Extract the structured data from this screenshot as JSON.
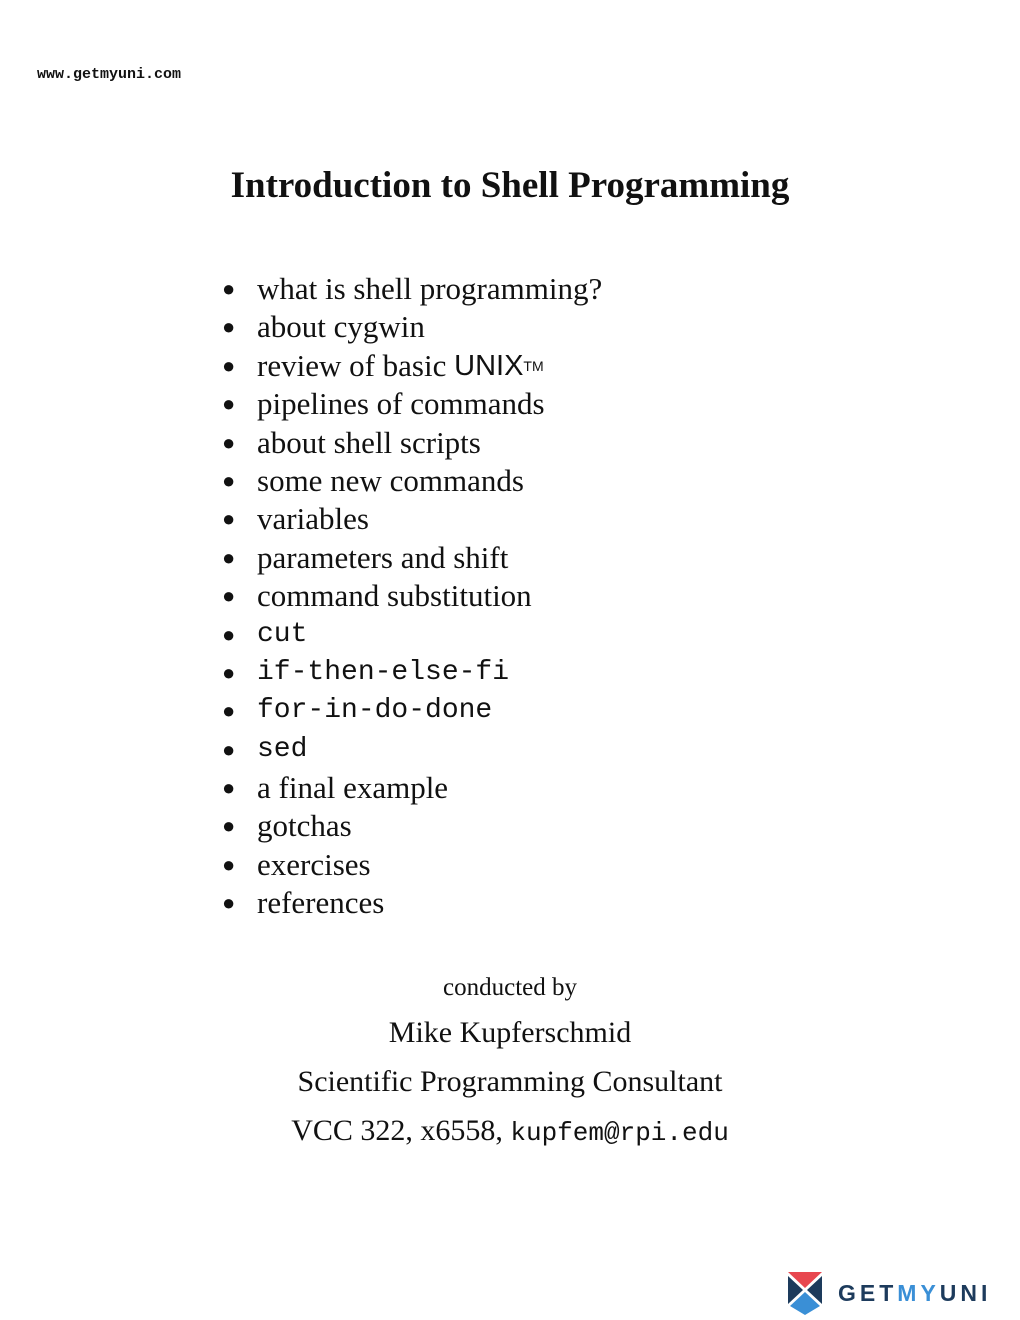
{
  "header": {
    "site_url": "www.getmyuni.com"
  },
  "title": "Introduction to Shell Programming",
  "topics": [
    {
      "text": "what is shell programming?",
      "mono": false
    },
    {
      "text": "about cygwin",
      "mono": false
    },
    {
      "text": "review of basic ",
      "suffix": "UNIX",
      "tm": "TM",
      "mono": false
    },
    {
      "text": "pipelines of commands",
      "mono": false
    },
    {
      "text": "about shell scripts",
      "mono": false
    },
    {
      "text": "some new commands",
      "mono": false
    },
    {
      "text": "variables",
      "mono": false
    },
    {
      "text": "parameters and shift",
      "mono": false
    },
    {
      "text": "command substitution",
      "mono": false
    },
    {
      "text": "cut",
      "mono": true
    },
    {
      "text": "if-then-else-fi",
      "mono": true
    },
    {
      "text": "for-in-do-done",
      "mono": true
    },
    {
      "text": "sed",
      "mono": true
    },
    {
      "text": "a final example",
      "mono": false
    },
    {
      "text": "gotchas",
      "mono": false
    },
    {
      "text": "exercises",
      "mono": false
    },
    {
      "text": "references",
      "mono": false
    }
  ],
  "credits": {
    "intro": "conducted by",
    "name": "Mike Kupferschmid",
    "role": "Scientific Programming Consultant",
    "contact_prefix": "VCC 322, x6558, ",
    "email": "kupfem@rpi.edu"
  },
  "logo": {
    "word_a": "GET",
    "word_b": "MY",
    "word_c": "UNI",
    "colors": {
      "navy": "#1d3b5c",
      "blue": "#3a8fd6",
      "red": "#e8474f"
    }
  }
}
